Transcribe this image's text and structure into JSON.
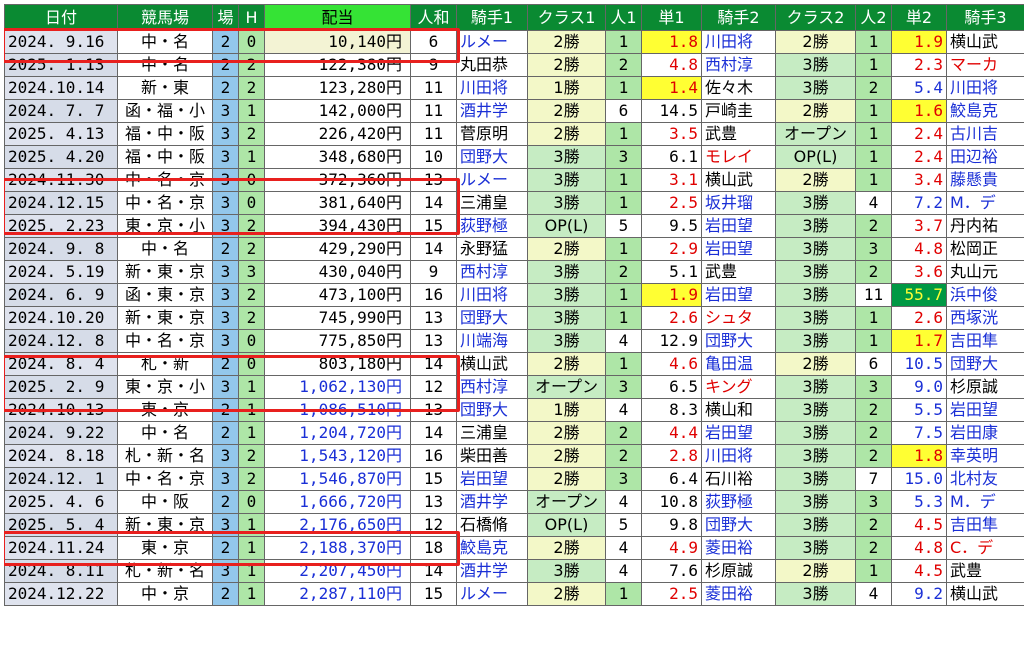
{
  "headers": [
    "日付",
    "競馬場",
    "場",
    "H",
    "配当",
    "人和",
    "騎手1",
    "クラス1",
    "人1",
    "単1",
    "騎手2",
    "クラス2",
    "人2",
    "単2",
    "騎手3"
  ],
  "rows": [
    {
      "date": "2024. 9.16",
      "venue": "中・名",
      "ba": "2",
      "h": "0",
      "pay": "10,140円",
      "ninwa": "6",
      "j1": "ルメー",
      "c1": "2勝",
      "n1": "1",
      "o1": "1.8",
      "j2": "川田将",
      "c2": "2勝",
      "n2": "1",
      "o2": "1.9",
      "j3": "横山武"
    },
    {
      "date": "2025. 1.13",
      "venue": "中・名",
      "ba": "2",
      "h": "2",
      "pay": "122,380円",
      "ninwa": "9",
      "j1": "丸田恭",
      "c1": "2勝",
      "n1": "2",
      "o1": "4.8",
      "j2": "西村淳",
      "c2": "3勝",
      "n2": "1",
      "o2": "2.3",
      "j3": "マーカ"
    },
    {
      "date": "2024.10.14",
      "venue": "新・東",
      "ba": "2",
      "h": "2",
      "pay": "123,280円",
      "ninwa": "11",
      "j1": "川田将",
      "c1": "1勝",
      "n1": "1",
      "o1": "1.4",
      "j2": "佐々木",
      "c2": "3勝",
      "n2": "2",
      "o2": "5.4",
      "j3": "川田将"
    },
    {
      "date": "2024. 7. 7",
      "venue": "函・福・小",
      "ba": "3",
      "h": "1",
      "pay": "142,000円",
      "ninwa": "11",
      "j1": "酒井学",
      "c1": "2勝",
      "n1": "6",
      "o1": "14.5",
      "j2": "戸崎圭",
      "c2": "2勝",
      "n2": "1",
      "o2": "1.6",
      "j3": "鮫島克"
    },
    {
      "date": "2025. 4.13",
      "venue": "福・中・阪",
      "ba": "3",
      "h": "2",
      "pay": "226,420円",
      "ninwa": "11",
      "j1": "菅原明",
      "c1": "2勝",
      "n1": "1",
      "o1": "3.5",
      "j2": "武豊",
      "c2": "オープン",
      "n2": "1",
      "o2": "2.4",
      "j3": "古川吉"
    },
    {
      "date": "2025. 4.20",
      "venue": "福・中・阪",
      "ba": "3",
      "h": "1",
      "pay": "348,680円",
      "ninwa": "10",
      "j1": "団野大",
      "c1": "3勝",
      "n1": "3",
      "o1": "6.1",
      "j2": "モレイ",
      "c2": "OP(L)",
      "n2": "1",
      "o2": "2.4",
      "j3": "田辺裕"
    },
    {
      "date": "2024.11.30",
      "venue": "中・名・京",
      "ba": "3",
      "h": "0",
      "pay": "372,360円",
      "ninwa": "13",
      "j1": "ルメー",
      "c1": "3勝",
      "n1": "1",
      "o1": "3.1",
      "j2": "横山武",
      "c2": "2勝",
      "n2": "1",
      "o2": "3.4",
      "j3": "藤懸貴"
    },
    {
      "date": "2024.12.15",
      "venue": "中・名・京",
      "ba": "3",
      "h": "0",
      "pay": "381,640円",
      "ninwa": "14",
      "j1": "三浦皇",
      "c1": "3勝",
      "n1": "1",
      "o1": "2.5",
      "j2": "坂井瑠",
      "c2": "3勝",
      "n2": "4",
      "o2": "7.2",
      "j3": "M．デ"
    },
    {
      "date": "2025. 2.23",
      "venue": "東・京・小",
      "ba": "3",
      "h": "2",
      "pay": "394,430円",
      "ninwa": "15",
      "j1": "荻野極",
      "c1": "OP(L)",
      "n1": "5",
      "o1": "9.5",
      "j2": "岩田望",
      "c2": "3勝",
      "n2": "2",
      "o2": "3.7",
      "j3": "丹内祐"
    },
    {
      "date": "2024. 9. 8",
      "venue": "中・名",
      "ba": "2",
      "h": "2",
      "pay": "429,290円",
      "ninwa": "14",
      "j1": "永野猛",
      "c1": "2勝",
      "n1": "1",
      "o1": "2.9",
      "j2": "岩田望",
      "c2": "3勝",
      "n2": "3",
      "o2": "4.8",
      "j3": "松岡正"
    },
    {
      "date": "2024. 5.19",
      "venue": "新・東・京",
      "ba": "3",
      "h": "3",
      "pay": "430,040円",
      "ninwa": "9",
      "j1": "西村淳",
      "c1": "3勝",
      "n1": "2",
      "o1": "5.1",
      "j2": "武豊",
      "c2": "3勝",
      "n2": "2",
      "o2": "3.6",
      "j3": "丸山元"
    },
    {
      "date": "2024. 6. 9",
      "venue": "函・東・京",
      "ba": "3",
      "h": "2",
      "pay": "473,100円",
      "ninwa": "16",
      "j1": "川田将",
      "c1": "3勝",
      "n1": "1",
      "o1": "1.9",
      "j2": "岩田望",
      "c2": "3勝",
      "n2": "11",
      "o2": "55.7",
      "j3": "浜中俊"
    },
    {
      "date": "2024.10.20",
      "venue": "新・東・京",
      "ba": "3",
      "h": "2",
      "pay": "745,990円",
      "ninwa": "13",
      "j1": "団野大",
      "c1": "3勝",
      "n1": "1",
      "o1": "2.6",
      "j2": "シュタ",
      "c2": "3勝",
      "n2": "1",
      "o2": "2.6",
      "j3": "西塚洸"
    },
    {
      "date": "2024.12. 8",
      "venue": "中・名・京",
      "ba": "3",
      "h": "0",
      "pay": "775,850円",
      "ninwa": "13",
      "j1": "川端海",
      "c1": "3勝",
      "n1": "4",
      "o1": "12.9",
      "j2": "団野大",
      "c2": "3勝",
      "n2": "1",
      "o2": "1.7",
      "j3": "吉田隼"
    },
    {
      "date": "2024. 8. 4",
      "venue": "札・新",
      "ba": "2",
      "h": "0",
      "pay": "803,180円",
      "ninwa": "14",
      "j1": "横山武",
      "c1": "2勝",
      "n1": "1",
      "o1": "4.6",
      "j2": "亀田温",
      "c2": "2勝",
      "n2": "6",
      "o2": "10.5",
      "j3": "団野大"
    },
    {
      "date": "2025. 2. 9",
      "venue": "東・京・小",
      "ba": "3",
      "h": "1",
      "pay": "1,062,130円",
      "ninwa": "12",
      "j1": "西村淳",
      "c1": "オープン",
      "n1": "3",
      "o1": "6.5",
      "j2": "キング",
      "c2": "3勝",
      "n2": "3",
      "o2": "9.0",
      "j3": "杉原誠"
    },
    {
      "date": "2024.10.13",
      "venue": "東・京",
      "ba": "2",
      "h": "1",
      "pay": "1,086,510円",
      "ninwa": "13",
      "j1": "団野大",
      "c1": "1勝",
      "n1": "4",
      "o1": "8.3",
      "j2": "横山和",
      "c2": "3勝",
      "n2": "2",
      "o2": "5.5",
      "j3": "岩田望"
    },
    {
      "date": "2024. 9.22",
      "venue": "中・名",
      "ba": "2",
      "h": "1",
      "pay": "1,204,720円",
      "ninwa": "14",
      "j1": "三浦皇",
      "c1": "2勝",
      "n1": "2",
      "o1": "4.4",
      "j2": "岩田望",
      "c2": "3勝",
      "n2": "2",
      "o2": "7.5",
      "j3": "岩田康"
    },
    {
      "date": "2024. 8.18",
      "venue": "札・新・名",
      "ba": "3",
      "h": "2",
      "pay": "1,543,120円",
      "ninwa": "16",
      "j1": "柴田善",
      "c1": "2勝",
      "n1": "2",
      "o1": "2.8",
      "j2": "川田将",
      "c2": "3勝",
      "n2": "2",
      "o2": "1.8",
      "j3": "幸英明"
    },
    {
      "date": "2024.12. 1",
      "venue": "中・名・京",
      "ba": "3",
      "h": "2",
      "pay": "1,546,870円",
      "ninwa": "15",
      "j1": "岩田望",
      "c1": "2勝",
      "n1": "3",
      "o1": "6.4",
      "j2": "石川裕",
      "c2": "3勝",
      "n2": "7",
      "o2": "15.0",
      "j3": "北村友"
    },
    {
      "date": "2025. 4. 6",
      "venue": "中・阪",
      "ba": "2",
      "h": "0",
      "pay": "1,666,720円",
      "ninwa": "13",
      "j1": "酒井学",
      "c1": "オープン",
      "n1": "4",
      "o1": "10.8",
      "j2": "荻野極",
      "c2": "3勝",
      "n2": "3",
      "o2": "5.3",
      "j3": "M．デ"
    },
    {
      "date": "2025. 5. 4",
      "venue": "新・東・京",
      "ba": "3",
      "h": "1",
      "pay": "2,176,650円",
      "ninwa": "12",
      "j1": "石橋脩",
      "c1": "OP(L)",
      "n1": "5",
      "o1": "9.8",
      "j2": "団野大",
      "c2": "3勝",
      "n2": "2",
      "o2": "4.5",
      "j3": "吉田隼"
    },
    {
      "date": "2024.11.24",
      "venue": "東・京",
      "ba": "2",
      "h": "1",
      "pay": "2,188,370円",
      "ninwa": "18",
      "j1": "鮫島克",
      "c1": "2勝",
      "n1": "4",
      "o1": "4.9",
      "j2": "菱田裕",
      "c2": "3勝",
      "n2": "2",
      "o2": "4.8",
      "j3": "C．デ"
    },
    {
      "date": "2024. 8.11",
      "venue": "札・新・名",
      "ba": "3",
      "h": "1",
      "pay": "2,207,450円",
      "ninwa": "14",
      "j1": "酒井学",
      "c1": "3勝",
      "n1": "4",
      "o1": "7.6",
      "j2": "杉原誠",
      "c2": "2勝",
      "n2": "1",
      "o2": "4.5",
      "j3": "武豊"
    },
    {
      "date": "2024.12.22",
      "venue": "中・京",
      "ba": "2",
      "h": "1",
      "pay": "2,287,110円",
      "ninwa": "15",
      "j1": "ルメー",
      "c1": "2勝",
      "n1": "1",
      "o1": "2.5",
      "j2": "菱田裕",
      "c2": "3勝",
      "n2": "4",
      "o2": "9.2",
      "j3": "横山武"
    }
  ],
  "colors": {
    "header_bg": "#0a8a32",
    "haito_header": "#35e335",
    "highlight_red": "#e8201e",
    "odds_yellow": "#ffff33",
    "blue_text": "#1a2fd6",
    "red_text": "#e00000"
  }
}
